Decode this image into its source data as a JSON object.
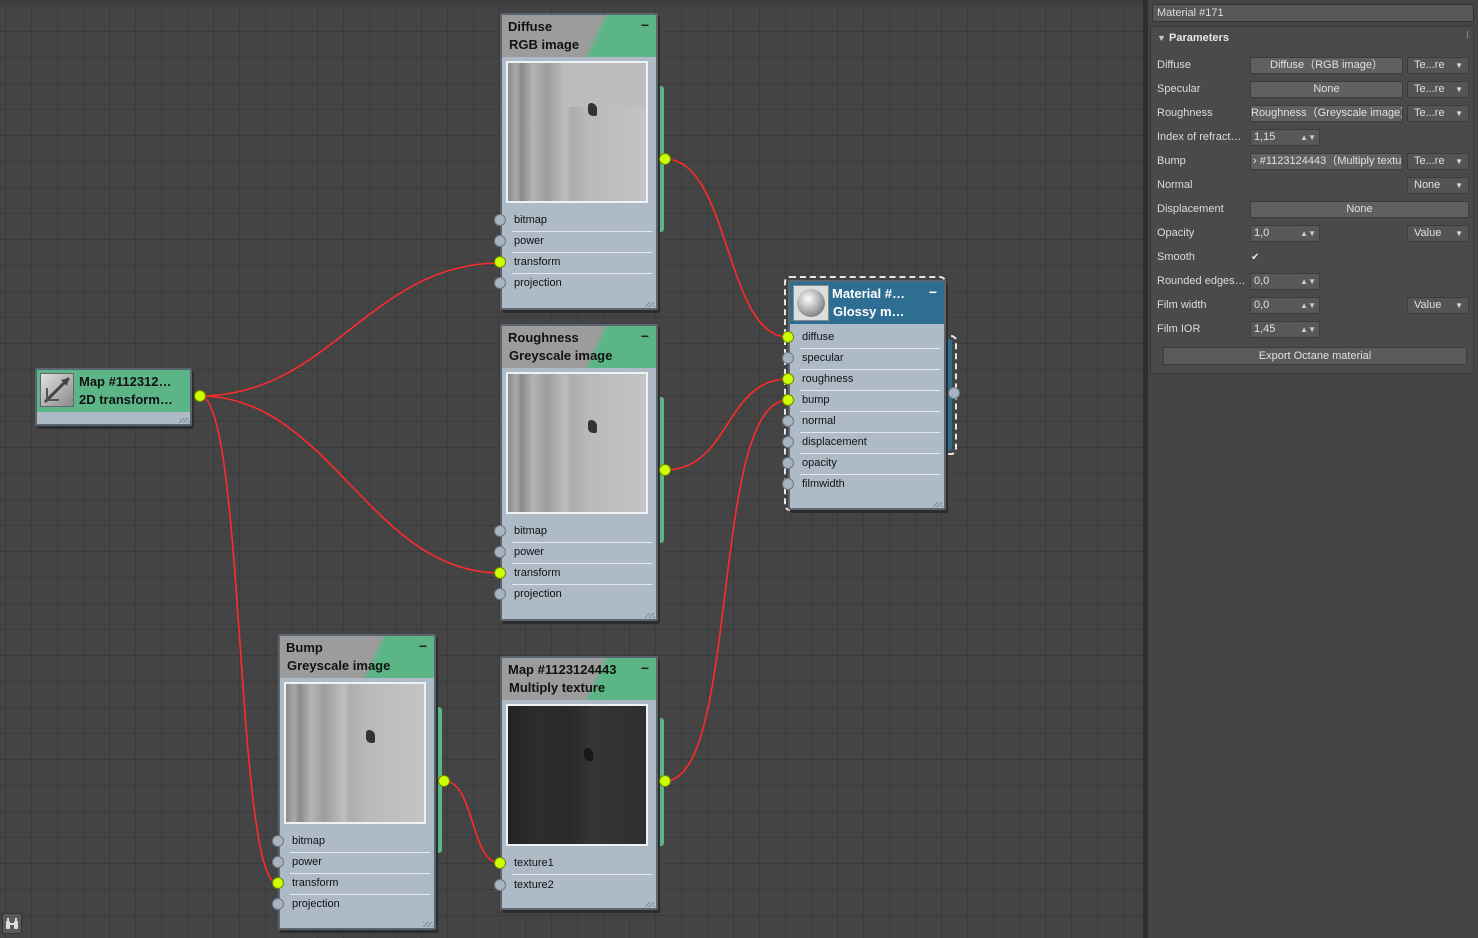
{
  "nodes": {
    "diffuse": {
      "title": "Diffuse",
      "subtitle": "RGB image",
      "sockets": [
        "bitmap",
        "power",
        "transform",
        "projection"
      ]
    },
    "roughness": {
      "title": "Roughness",
      "subtitle": "Greyscale image",
      "sockets": [
        "bitmap",
        "power",
        "transform",
        "projection"
      ]
    },
    "bump": {
      "title": "Bump",
      "subtitle": "Greyscale image",
      "sockets": [
        "bitmap",
        "power",
        "transform",
        "projection"
      ]
    },
    "multiply": {
      "title": "Map #1123124443",
      "subtitle": "Multiply texture",
      "sockets": [
        "texture1",
        "texture2"
      ]
    },
    "transform": {
      "title": "Map #112312…",
      "subtitle": "2D transform…"
    },
    "material": {
      "title": "Material #…",
      "subtitle": "Glossy m…",
      "sockets": [
        "diffuse",
        "specular",
        "roughness",
        "bump",
        "normal",
        "displacement",
        "opacity",
        "filmwidth"
      ]
    },
    "minimize_glyph": "−"
  },
  "panel": {
    "material_name": "Material #171",
    "section_title": "Parameters",
    "rows": {
      "diffuse": {
        "label": "Diffuse",
        "button": "Diffuse（RGB image）",
        "dropdown": "Te...re"
      },
      "specular": {
        "label": "Specular",
        "button": "None",
        "dropdown": "Te...re"
      },
      "roughness": {
        "label": "Roughness",
        "button": "Roughness（Greyscale image）",
        "dropdown": "Te...re"
      },
      "ior": {
        "label": "Index of refract…",
        "value": "1,15"
      },
      "bump": {
        "label": "Bump",
        "button": "› #1123124443（Multiply textu",
        "dropdown": "Te...re"
      },
      "normal": {
        "label": "Normal",
        "dropdown": "None"
      },
      "displacement": {
        "label": "Displacement",
        "button": "None"
      },
      "opacity": {
        "label": "Opacity",
        "value": "1,0",
        "dropdown": "Value"
      },
      "smooth": {
        "label": "Smooth",
        "checked": "✔"
      },
      "rounded": {
        "label": "Rounded edges…",
        "value": "0,0"
      },
      "filmwidth": {
        "label": "Film width",
        "value": "0,0",
        "dropdown": "Value"
      },
      "filmior": {
        "label": "Film IOR",
        "value": "1,45"
      }
    },
    "export_label": "Export Octane material"
  },
  "colors": {
    "wire": "#ff2a2a",
    "socket_active": "#ccff00",
    "node_header_green": "#5cb587",
    "material_header_blue": "#2f6e93"
  },
  "icons": {
    "transform_node_icon": "transform-icon",
    "material_preview": "sphere-icon",
    "corner": "binoculars-icon"
  }
}
